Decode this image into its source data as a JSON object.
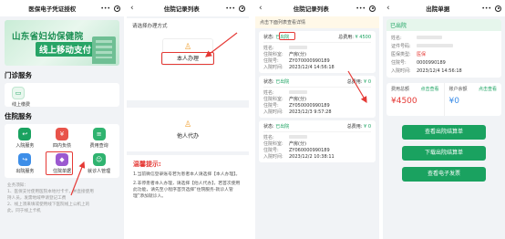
{
  "panel1": {
    "title": "医保电子凭证授权",
    "banner_line1": "山东省妇幼保健院",
    "banner_line2": "线上移动支付",
    "section_outpatient": "门诊服务",
    "outpatient_item": "线上缴费",
    "section_inpatient": "住院服务",
    "grid": [
      "入院服务",
      "四内负债",
      "费用查询",
      "出院服务",
      "住院单据",
      "就诊人管理"
    ],
    "notes": "业务须知：\n1、医保支付使用医院本地付卡卡，并直接使用\n持人员，发需地域申请登记工费\n2、线上须来填或使用线下医院线上公机上的\n此，同于线上卡机"
  },
  "panel2": {
    "title": "住院记录列表",
    "question": "请选择办理方式",
    "choice1": "本人办理",
    "choice2": "他人代办",
    "tips_title": "温馨提示:",
    "tips1": "1.当前微信登录账号若为患者本人请选择【本人办理】。",
    "tips2": "2.非停患者本人办理，请选择【他人代办】，若首次使用此功能，请先至小程序首页选择“住院服务-就诊人管理”添加就诊人。"
  },
  "panel3": {
    "title": "住院记录列表",
    "notice": "点击下面列表查看详情",
    "records": [
      {
        "status_label": "状态:",
        "status": "已出院",
        "fee_label": "总费用:",
        "fee": "¥ 4500",
        "name_label": "姓名:",
        "dept_label": "住院科室:",
        "dept": "产房(分)",
        "no_label": "住院号:",
        "no": "ZY070000990189",
        "date_label": "入院时间:",
        "date": "2023/12/4 14:56:18"
      },
      {
        "status_label": "状态:",
        "status": "已出院",
        "fee_label": "总费用:",
        "fee": "¥ 0",
        "name_label": "姓名:",
        "dept_label": "住院科室:",
        "dept": "产房(分)",
        "no_label": "住院号:",
        "no": "ZY050000990189",
        "date_label": "入院时间:",
        "date": "2023/12/3 9:57:28"
      },
      {
        "status_label": "状态:",
        "status": "已出院",
        "fee_label": "总费用:",
        "fee": "¥ 0",
        "name_label": "姓名:",
        "dept_label": "住院科室:",
        "dept": "产房(分)",
        "no_label": "住院号:",
        "no": "ZY060000990189",
        "date_label": "入院时间:",
        "date": "2023/12/2 10:38:11"
      }
    ]
  },
  "panel4": {
    "title": "出院单据",
    "status": "已出院",
    "rows": [
      {
        "k": "姓名:",
        "v": ""
      },
      {
        "k": "证件号码:",
        "v": ""
      },
      {
        "k": "医保类型:",
        "v": "医保"
      },
      {
        "k": "住院号:",
        "v": "0000990189"
      },
      {
        "k": "入院时间:",
        "v": "2023/12/4 14:56:18"
      }
    ],
    "fee_total_label": "费用总额",
    "fee_total_link": "点击查看",
    "fee_total": "¥4500",
    "fee_acct_label": "账户余额",
    "fee_acct_link": "点击查看",
    "fee_acct": "¥0",
    "btn1": "查看出院结算单",
    "btn2": "下载出院结算单",
    "btn3": "查看电子发票"
  },
  "common": {
    "menu_dots": "•••"
  },
  "colors": {
    "accent": "#1aa260",
    "alert": "#e53935"
  }
}
